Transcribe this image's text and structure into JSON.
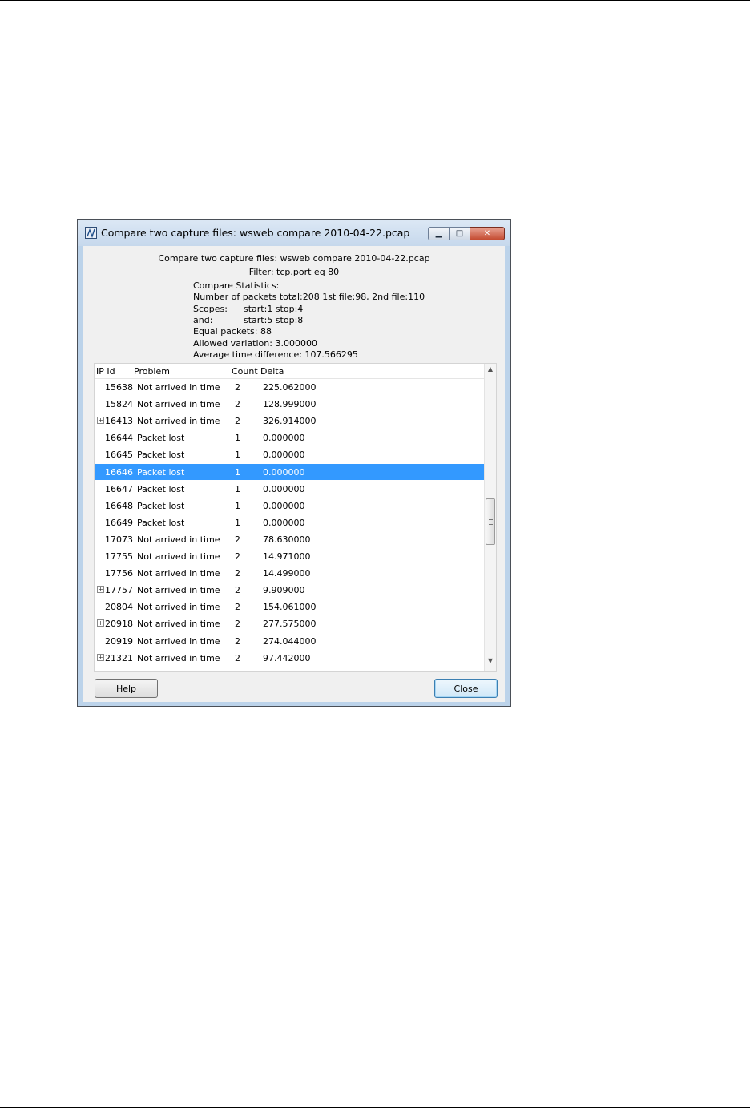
{
  "window": {
    "title": "Compare two capture files: wsweb compare 2010-04-22.pcap",
    "minimize_glyph": "▁",
    "maximize_glyph": "□",
    "close_glyph": "✕"
  },
  "summary": {
    "heading": "Compare two capture files: wsweb compare 2010-04-22.pcap",
    "filter": "Filter: tcp.port eq 80",
    "stats_title": "Compare Statistics:",
    "packets_total": "Number of packets total:208 1st file:98, 2nd file:110",
    "scopes_label": "Scopes:",
    "scopes_value": "start:1 stop:4",
    "and_label": "and:",
    "and_value": "start:5 stop:8",
    "equal_packets": "Equal packets: 88",
    "allowed_variation": "Allowed variation: 3.000000",
    "avg_time_diff": "Average time difference: 107.566295"
  },
  "table": {
    "columns": {
      "ip_id": "IP Id",
      "problem": "Problem",
      "count": "Count",
      "delta": "Delta"
    },
    "rows": [
      {
        "ip_id": "15638",
        "problem": "Not arrived in time",
        "count": "2",
        "delta": "225.062000",
        "expandable": false,
        "selected": false
      },
      {
        "ip_id": "15824",
        "problem": "Not arrived in time",
        "count": "2",
        "delta": "128.999000",
        "expandable": false,
        "selected": false
      },
      {
        "ip_id": "16413",
        "problem": "Not arrived in time",
        "count": "2",
        "delta": "326.914000",
        "expandable": true,
        "selected": false
      },
      {
        "ip_id": "16644",
        "problem": "Packet lost",
        "count": "1",
        "delta": "0.000000",
        "expandable": false,
        "selected": false
      },
      {
        "ip_id": "16645",
        "problem": "Packet lost",
        "count": "1",
        "delta": "0.000000",
        "expandable": false,
        "selected": false
      },
      {
        "ip_id": "16646",
        "problem": "Packet lost",
        "count": "1",
        "delta": "0.000000",
        "expandable": false,
        "selected": true
      },
      {
        "ip_id": "16647",
        "problem": "Packet lost",
        "count": "1",
        "delta": "0.000000",
        "expandable": false,
        "selected": false
      },
      {
        "ip_id": "16648",
        "problem": "Packet lost",
        "count": "1",
        "delta": "0.000000",
        "expandable": false,
        "selected": false
      },
      {
        "ip_id": "16649",
        "problem": "Packet lost",
        "count": "1",
        "delta": "0.000000",
        "expandable": false,
        "selected": false
      },
      {
        "ip_id": "17073",
        "problem": "Not arrived in time",
        "count": "2",
        "delta": "78.630000",
        "expandable": false,
        "selected": false
      },
      {
        "ip_id": "17755",
        "problem": "Not arrived in time",
        "count": "2",
        "delta": "14.971000",
        "expandable": false,
        "selected": false
      },
      {
        "ip_id": "17756",
        "problem": "Not arrived in time",
        "count": "2",
        "delta": "14.499000",
        "expandable": false,
        "selected": false
      },
      {
        "ip_id": "17757",
        "problem": "Not arrived in time",
        "count": "2",
        "delta": "9.909000",
        "expandable": true,
        "selected": false
      },
      {
        "ip_id": "20804",
        "problem": "Not arrived in time",
        "count": "2",
        "delta": "154.061000",
        "expandable": false,
        "selected": false
      },
      {
        "ip_id": "20918",
        "problem": "Not arrived in time",
        "count": "2",
        "delta": "277.575000",
        "expandable": true,
        "selected": false
      },
      {
        "ip_id": "20919",
        "problem": "Not arrived in time",
        "count": "2",
        "delta": "274.044000",
        "expandable": false,
        "selected": false
      },
      {
        "ip_id": "21321",
        "problem": "Not arrived in time",
        "count": "2",
        "delta": "97.442000",
        "expandable": true,
        "selected": false
      }
    ],
    "expander_glyph": "+",
    "selection_color": "#3399ff"
  },
  "scrollbar": {
    "up_glyph": "▲",
    "down_glyph": "▼"
  },
  "buttons": {
    "help": "Help",
    "close": "Close"
  },
  "icons": [
    "app-icon",
    "minimize-icon",
    "maximize-icon",
    "close-icon",
    "expand-icon",
    "scroll-up-icon",
    "scroll-down-icon"
  ]
}
